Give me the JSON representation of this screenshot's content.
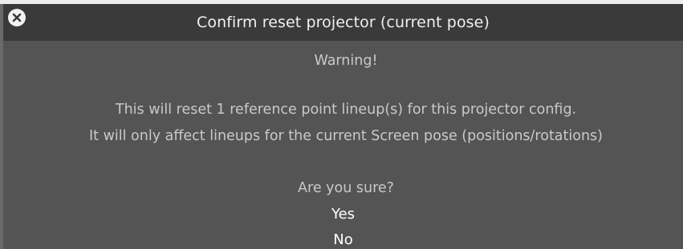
{
  "dialog": {
    "title": "Confirm reset projector (current pose)",
    "close_icon": "close-icon",
    "warning": "Warning!",
    "message_line1": "This will reset 1 reference point lineup(s) for this projector config.",
    "message_line2": "It will only affect lineups for the current Screen pose (positions/rotations)",
    "question": "Are you sure?",
    "yes_label": "Yes",
    "no_label": "No"
  },
  "colors": {
    "titlebar": "#3a3a3a",
    "background": "#545454",
    "text": "#c9c9c9",
    "choice_text": "#ffffff"
  }
}
